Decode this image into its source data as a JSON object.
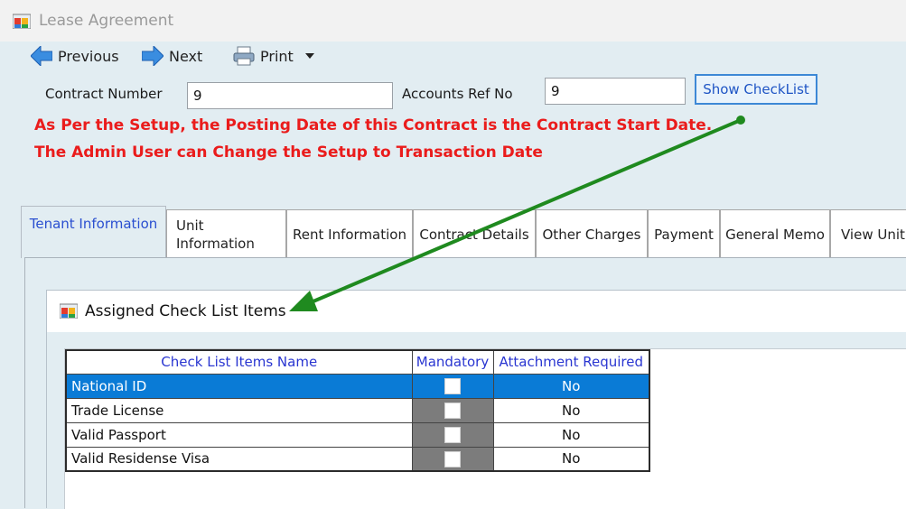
{
  "window": {
    "title": "Lease Agreement",
    "icon": "window-app-icon"
  },
  "toolbar": {
    "previous_label": "Previous",
    "next_label": "Next",
    "print_label": "Print"
  },
  "form": {
    "contract_number_label": "Contract Number",
    "contract_number_value": "9",
    "accounts_ref_label": "Accounts Ref No",
    "accounts_ref_value": "9",
    "show_checklist_label": "Show CheckList"
  },
  "messages": {
    "line1": "As Per the Setup, the Posting Date of this Contract is the Contract Start Date.",
    "line2": "The Admin User can Change the Setup to Transaction Date"
  },
  "tabs": [
    {
      "label": "Tenant Information",
      "active": true
    },
    {
      "label": "Unit Information"
    },
    {
      "label": "Rent Information"
    },
    {
      "label": "Contract Details"
    },
    {
      "label": "Other Charges"
    },
    {
      "label": "Payment"
    },
    {
      "label": "General Memo"
    },
    {
      "label": "View Unit"
    }
  ],
  "dialog": {
    "title": "Assigned Check List Items",
    "columns": [
      "Check List Items Name",
      "Mandatory",
      "Attachment Required"
    ],
    "rows": [
      {
        "name": "National ID",
        "mandatory": false,
        "attachment": "No",
        "selected": true
      },
      {
        "name": "Trade License",
        "mandatory": false,
        "attachment": "No"
      },
      {
        "name": "Valid Passport",
        "mandatory": false,
        "attachment": "No"
      },
      {
        "name": "Valid Residense Visa",
        "mandatory": false,
        "attachment": "No"
      }
    ]
  },
  "colors": {
    "warning": "#ea1c1c",
    "selection": "#0a7bd6",
    "header_text": "#2a36d1",
    "annotation_arrow": "#1f8a1f"
  }
}
